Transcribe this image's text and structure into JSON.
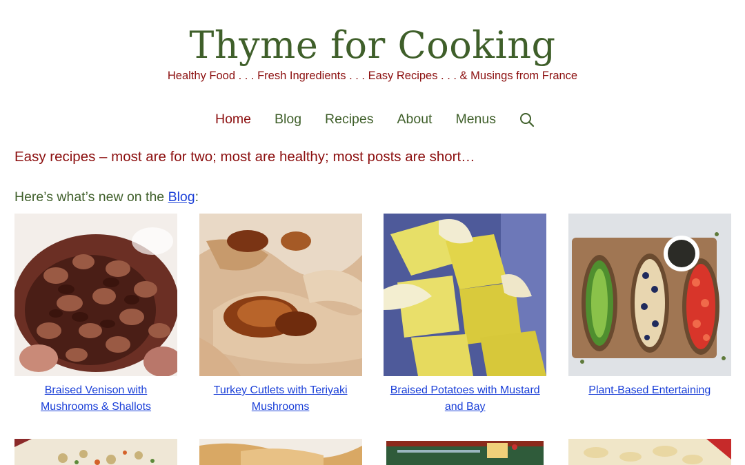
{
  "site": {
    "title": "Thyme for Cooking",
    "tagline": "Healthy Food . . . Fresh Ingredients . . . Easy Recipes . . . & Musings from France"
  },
  "nav": {
    "items": [
      {
        "label": "Home",
        "active": true
      },
      {
        "label": "Blog"
      },
      {
        "label": "Recipes"
      },
      {
        "label": "About"
      },
      {
        "label": "Menus"
      }
    ],
    "search_icon": "search-icon"
  },
  "intro": "Easy recipes – most are for two; most are healthy; most posts are short…",
  "blog_line": {
    "prefix": "Here’s what’s new on the ",
    "link": "Blog",
    "suffix": ":"
  },
  "posts": [
    {
      "title": "Braised Venison with Mushrooms & Shallots"
    },
    {
      "title": "Turkey Cutlets with Teriyaki Mushrooms"
    },
    {
      "title": "Braised Potatoes with Mustard and Bay"
    },
    {
      "title": "Plant-Based Entertaining"
    }
  ],
  "colors": {
    "brand_green": "#3f5f2a",
    "accent_red": "#8b0e0e",
    "link_blue": "#1a3fd8"
  }
}
